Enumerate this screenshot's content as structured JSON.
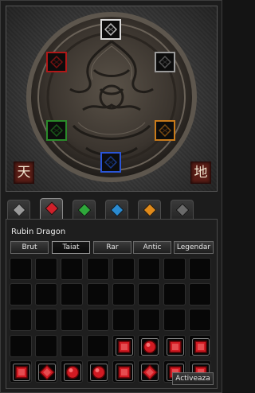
{
  "seals": {
    "heaven": "天",
    "earth": "地"
  },
  "socket_icons": [
    {
      "name": "white-socket",
      "color": "#d8d8d8"
    },
    {
      "name": "red-socket",
      "color": "#b01818"
    },
    {
      "name": "black-socket",
      "color": "#9a9a9a"
    },
    {
      "name": "green-socket",
      "color": "#2a8a2a"
    },
    {
      "name": "orange-socket",
      "color": "#c87a1a"
    },
    {
      "name": "blue-socket",
      "color": "#2a55d8"
    }
  ],
  "tabs": [
    {
      "name": "gray-gem-tab",
      "color": "#9a9a9a",
      "active": false
    },
    {
      "name": "ruby-gem-tab",
      "color": "#d0202a",
      "active": true
    },
    {
      "name": "emerald-gem-tab",
      "color": "#2ea83a",
      "active": false
    },
    {
      "name": "sapphire-gem-tab",
      "color": "#2a8ad0",
      "active": false
    },
    {
      "name": "amber-gem-tab",
      "color": "#e08a1a",
      "active": false
    },
    {
      "name": "onyx-gem-tab",
      "color": "#6a6a6a",
      "active": false
    }
  ],
  "selected_gem": "Rubin Dragon",
  "grades": [
    "Brut",
    "Taiat",
    "Rar",
    "Antic",
    "Legendar"
  ],
  "active_grade": "Taiat",
  "inventory": {
    "rows": 5,
    "cols": 8,
    "items": [
      {
        "row": 3,
        "col": 4,
        "icon": "ruby-square"
      },
      {
        "row": 3,
        "col": 5,
        "icon": "ruby-round"
      },
      {
        "row": 3,
        "col": 6,
        "icon": "ruby-square"
      },
      {
        "row": 3,
        "col": 7,
        "icon": "ruby-square"
      },
      {
        "row": 4,
        "col": 0,
        "icon": "ruby-square"
      },
      {
        "row": 4,
        "col": 1,
        "icon": "ruby-diamond"
      },
      {
        "row": 4,
        "col": 2,
        "icon": "ruby-round"
      },
      {
        "row": 4,
        "col": 3,
        "icon": "ruby-round"
      },
      {
        "row": 4,
        "col": 4,
        "icon": "ruby-square"
      },
      {
        "row": 4,
        "col": 5,
        "icon": "ruby-diamond"
      },
      {
        "row": 4,
        "col": 6,
        "icon": "ruby-square"
      },
      {
        "row": 4,
        "col": 7,
        "icon": "ruby-square"
      }
    ]
  },
  "activate_button": "Activeaza",
  "colors": {
    "ruby": "#d11a22",
    "ruby_dark": "#5a0306",
    "ruby_light": "#ff8a8a"
  }
}
